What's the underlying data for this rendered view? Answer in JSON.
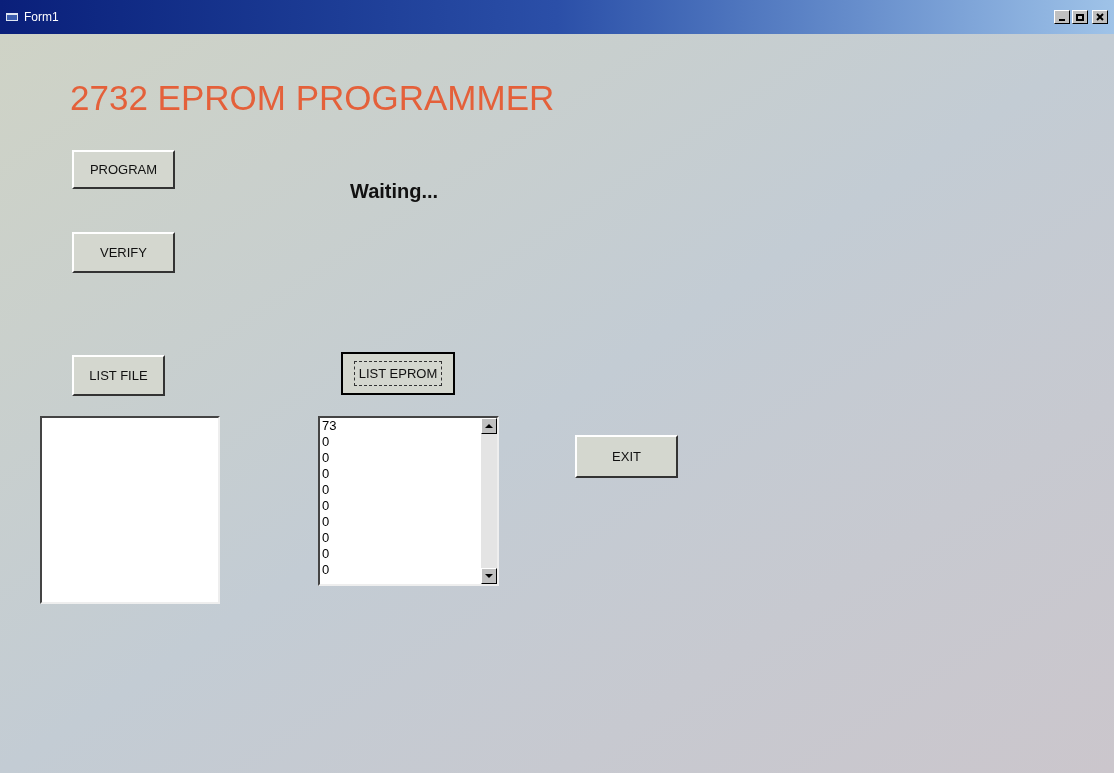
{
  "window": {
    "title": "Form1"
  },
  "heading": "2732 EPROM PROGRAMMER",
  "status": "Waiting...",
  "buttons": [
    {
      "label": "PROGRAM",
      "focused": false
    },
    {
      "label": "VERIFY",
      "focused": false
    },
    {
      "label": "LIST FILE",
      "focused": false
    },
    {
      "label": "LIST EPROM",
      "focused": true
    },
    {
      "label": "EXIT",
      "focused": false
    }
  ],
  "eprom_list": {
    "items": [
      "73",
      "0",
      "0",
      "0",
      "0",
      "0",
      "0",
      "0",
      "0",
      "0"
    ]
  }
}
